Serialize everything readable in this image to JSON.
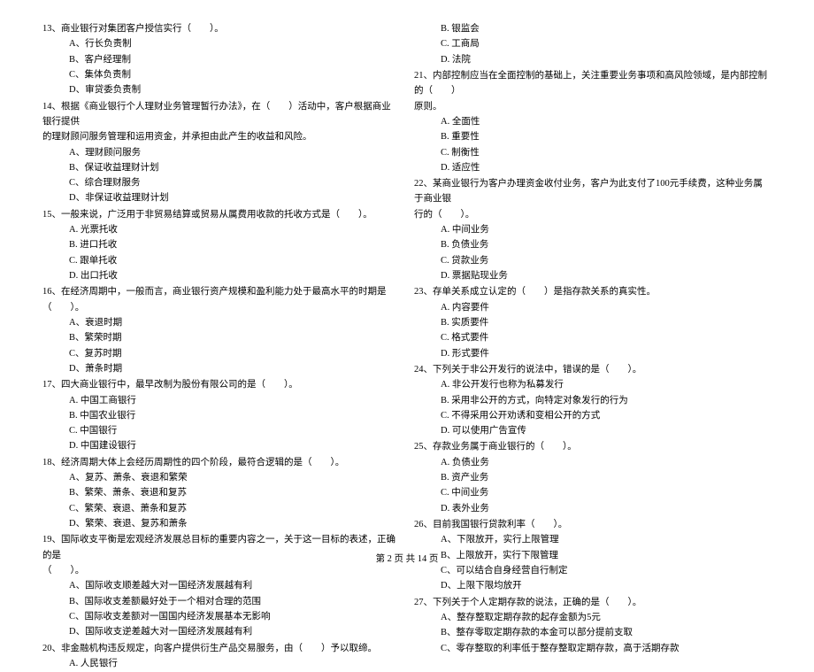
{
  "footer": "第 2 页 共 14 页",
  "left": {
    "q13": {
      "stem": "13、商业银行对集团客户授信实行（　　）。",
      "A": "A、行长负责制",
      "B": "B、客户经理制",
      "C": "C、集体负责制",
      "D": "D、审贷委负责制"
    },
    "q14": {
      "stem": "14、根据《商业银行个人理财业务管理暂行办法》，在（　　）活动中，客户根据商业银行提供",
      "stem2": "的理财顾问服务管理和运用资金，并承担由此产生的收益和风险。",
      "A": "A、理财顾问服务",
      "B": "B、保证收益理财计划",
      "C": "C、综合理财服务",
      "D": "D、非保证收益理财计划"
    },
    "q15": {
      "stem": "15、一般来说，广泛用于非贸易结算或贸易从属费用收款的托收方式是（　　）。",
      "A": "A. 光票托收",
      "B": "B. 进口托收",
      "C": "C. 跟单托收",
      "D": "D. 出口托收"
    },
    "q16": {
      "stem": "16、在经济周期中，一般而言，商业银行资产规模和盈利能力处于最高水平的时期是（　　）。",
      "A": "A、衰退时期",
      "B": "B、繁荣时期",
      "C": "C、复苏时期",
      "D": "D、萧条时期"
    },
    "q17": {
      "stem": "17、四大商业银行中，最早改制为股份有限公司的是（　　）。",
      "A": "A. 中国工商银行",
      "B": "B. 中国农业银行",
      "C": "C. 中国银行",
      "D": "D. 中国建设银行"
    },
    "q18": {
      "stem": "18、经济周期大体上会经历周期性的四个阶段，最符合逻辑的是（　　）。",
      "A": "A、复苏、萧条、衰退和繁荣",
      "B": "B、繁荣、萧条、衰退和复苏",
      "C": "C、繁荣、衰退、萧条和复苏",
      "D": "D、繁荣、衰退、复苏和萧条"
    },
    "q19": {
      "stem": "19、国际收支平衡是宏观经济发展总目标的重要内容之一，关于这一目标的表述，正确的是",
      "stem2": "（　　）。",
      "A": "A、国际收支顺差越大对一国经济发展越有利",
      "B": "B、国际收支差额最好处于一个相对合理的范围",
      "C": "C、国际收支差额对一国国内经济发展基本无影响",
      "D": "D、国际收支逆差越大对一国经济发展越有利"
    },
    "q20": {
      "stem": "20、非金融机构违反规定，向客户提供衍生产品交易服务，由（　　）予以取缔。",
      "A": "A. 人民银行"
    }
  },
  "right": {
    "q20tail": {
      "B": "B. 银监会",
      "C": "C. 工商局",
      "D": "D. 法院"
    },
    "q21": {
      "stem": "21、内部控制应当在全面控制的基础上，关注重要业务事项和高风险领域，是内部控制的（　　）",
      "stem2": "原则。",
      "A": "A. 全面性",
      "B": "B. 重要性",
      "C": "C. 制衡性",
      "D": "D. 适应性"
    },
    "q22": {
      "stem": "22、某商业银行为客户办理资金收付业务，客户为此支付了100元手续费，这种业务属于商业银",
      "stem2": "行的（　　）。",
      "A": "A. 中间业务",
      "B": "B. 负债业务",
      "C": "C. 贷款业务",
      "D": "D. 票据贴现业务"
    },
    "q23": {
      "stem": "23、存单关系成立认定的（　　）是指存款关系的真实性。",
      "A": "A. 内容要件",
      "B": "B. 实质要件",
      "C": "C. 格式要件",
      "D": "D. 形式要件"
    },
    "q24": {
      "stem": "24、下列关于非公开发行的说法中，错误的是（　　）。",
      "A": "A. 非公开发行也称为私募发行",
      "B": "B. 采用非公开的方式，向特定对象发行的行为",
      "C": "C. 不得采用公开劝诱和变相公开的方式",
      "D": "D. 可以使用广告宣传"
    },
    "q25": {
      "stem": "25、存款业务属于商业银行的（　　）。",
      "A": "A. 负债业务",
      "B": "B. 资产业务",
      "C": "C. 中间业务",
      "D": "D. 表外业务"
    },
    "q26": {
      "stem": "26、目前我国银行贷款利率（　　）。",
      "A": "A、下限放开，实行上限管理",
      "B": "B、上限放开，实行下限管理",
      "C": "C、可以结合自身经营自行制定",
      "D": "D、上限下限均放开"
    },
    "q27": {
      "stem": "27、下列关于个人定期存款的说法，正确的是（　　）。",
      "A": "A、整存整取定期存款的起存金额为5元",
      "B": "B、整存零取定期存款的本金可以部分提前支取",
      "C": "C、零存整取的利率低于整存整取定期存款，高于活期存款"
    }
  }
}
